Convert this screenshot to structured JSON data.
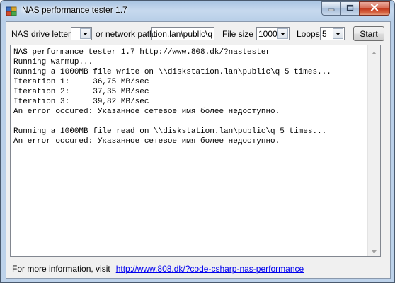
{
  "window": {
    "title": "NAS performance tester 1.7"
  },
  "toolbar": {
    "drive_label": "NAS drive letter",
    "drive_value": "",
    "network_label": "or network path",
    "network_value": "\\\\diskstation.lan\\public\\q",
    "filesize_label": "File size",
    "filesize_value": "1000",
    "loops_label": "Loops",
    "loops_value": "5",
    "start_label": "Start"
  },
  "log": {
    "lines": [
      "NAS performance tester 1.7 http://www.808.dk/?nastester",
      "Running warmup...",
      "Running a 1000MB file write on \\\\diskstation.lan\\public\\q 5 times...",
      "Iteration 1:     36,75 MB/sec",
      "Iteration 2:     37,35 MB/sec",
      "Iteration 3:     39,82 MB/sec",
      "An error occured: Указанное сетевое имя более недоступно.",
      "",
      "Running a 1000MB file read on \\\\diskstation.lan\\public\\q 5 times...",
      "An error occured: Указанное сетевое имя более недоступно."
    ]
  },
  "footer": {
    "text": "For more information, visit",
    "link": "http://www.808.dk/?code-csharp-nas-performance"
  },
  "icons": {
    "app": "app-icon",
    "minimize": "minimize-icon",
    "maximize": "maximize-icon",
    "close": "close-icon",
    "dropdown": "chevron-down-icon"
  }
}
